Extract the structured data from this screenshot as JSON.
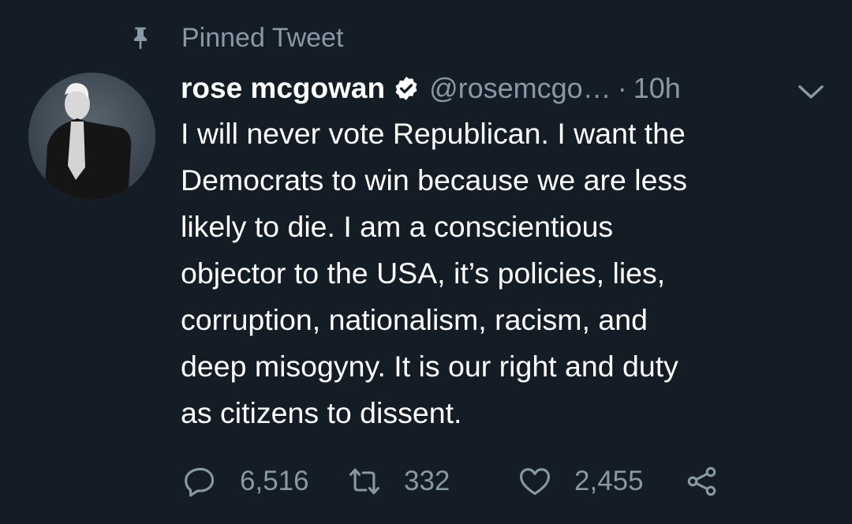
{
  "pinned": {
    "label": "Pinned Tweet",
    "icon": "pin-icon"
  },
  "author": {
    "display_name": "rose mcgowan",
    "handle": "@rosemcgo…",
    "separator": "·",
    "time": "10h",
    "verified_icon": "verified-badge-icon"
  },
  "tweet": {
    "text": "I will never vote Republican. I want the\nDemocrats to win because we are less\nlikely to die. I am a conscientious\nobjector to the USA, it’s policies, lies,\ncorruption, nationalism, racism, and\ndeep misogyny. It is our right and duty\nas citizens to dissent."
  },
  "actions": {
    "replies": "6,516",
    "retweets": "332",
    "likes": "2,455"
  },
  "colors": {
    "background": "#141d26",
    "muted": "#8899a6",
    "text": "#ffffff"
  }
}
